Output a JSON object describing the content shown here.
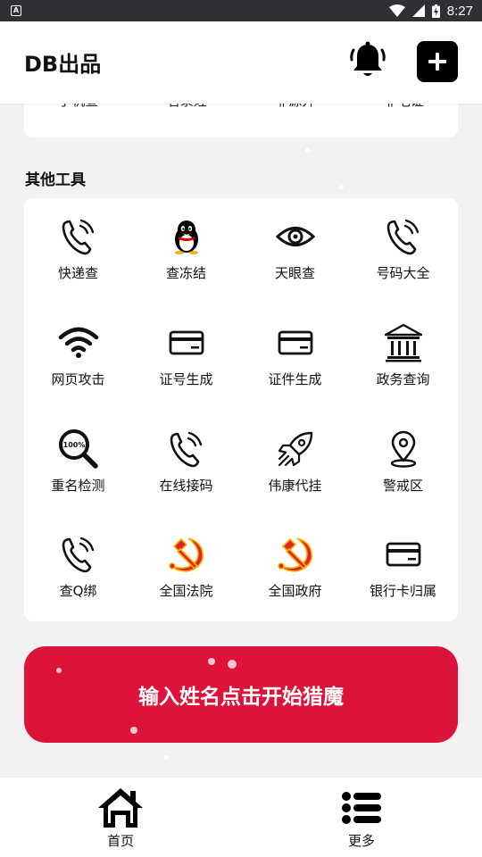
{
  "status_bar": {
    "time": "8:27",
    "app_icon_letter": "A"
  },
  "header": {
    "title": "DB出品",
    "bell_icon": "bell-icon",
    "add_icon": "plus-icon"
  },
  "top_card": {
    "items": [
      "手机查",
      "名录姓",
      "非源开",
      "非毛证"
    ]
  },
  "section_title": "其他工具",
  "tools": [
    {
      "label": "快递查",
      "icon": "phone-ringing-icon"
    },
    {
      "label": "查冻结",
      "icon": "qq-penguin-icon"
    },
    {
      "label": "天眼查",
      "icon": "eye-icon"
    },
    {
      "label": "号码大全",
      "icon": "phone-ringing-icon"
    },
    {
      "label": "网页攻击",
      "icon": "wifi-icon"
    },
    {
      "label": "证号生成",
      "icon": "card-icon"
    },
    {
      "label": "证件生成",
      "icon": "card-icon"
    },
    {
      "label": "政务查询",
      "icon": "government-building-icon"
    },
    {
      "label": "重名检测",
      "icon": "magnifier-100-icon",
      "icon_text": "100%"
    },
    {
      "label": "在线接码",
      "icon": "phone-ringing-icon"
    },
    {
      "label": "伟康代挂",
      "icon": "rocket-icon"
    },
    {
      "label": "警戒区",
      "icon": "location-pin-icon"
    },
    {
      "label": "查Q绑",
      "icon": "phone-ringing-icon"
    },
    {
      "label": "全国法院",
      "icon": "hammer-sickle-icon"
    },
    {
      "label": "全国政府",
      "icon": "hammer-sickle-icon"
    },
    {
      "label": "银行卡归属",
      "icon": "card-icon"
    }
  ],
  "hunt_button": {
    "label": "输入姓名点击开始猎魔",
    "color": "#dc143c"
  },
  "bottom_nav": [
    {
      "label": "首页",
      "icon": "home-icon"
    },
    {
      "label": "更多",
      "icon": "list-icon"
    }
  ]
}
